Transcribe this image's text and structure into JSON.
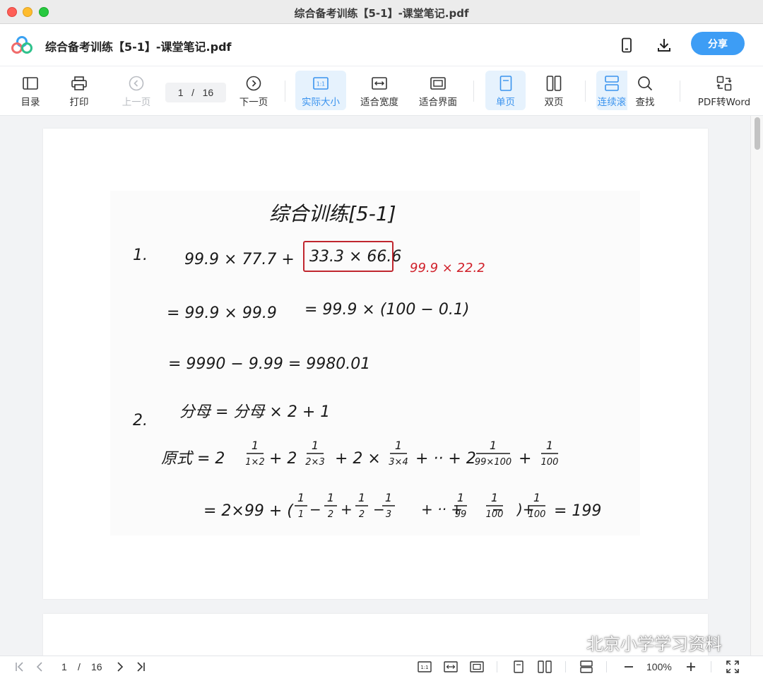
{
  "window": {
    "title": "综合备考训练【5-1】-课堂笔记.pdf"
  },
  "header": {
    "doc_title": "综合备考训练【5-1】-课堂笔记.pdf",
    "share_label": "分享",
    "icons": [
      "phone-icon",
      "download-icon"
    ]
  },
  "toolbar": {
    "toc": "目录",
    "print": "打印",
    "prev_page": "上一页",
    "current_page": "1",
    "page_sep": "/",
    "total_pages": "16",
    "next_page": "下一页",
    "actual_size": "实际大小",
    "fit_width": "适合宽度",
    "fit_window": "适合界面",
    "single_page": "单页",
    "double_page": "双页",
    "continuous": "连续滚",
    "find": "查找",
    "pdf_to_word": "PDF转Word"
  },
  "notes": {
    "title": "综合训练[5-1]",
    "q1_num": "1.",
    "q1_expr": "99.9 × 77.7 +",
    "q1_box": "33.3 × 66.6",
    "q1_red": "99.9 × 22.2",
    "q1_line2a": "= 99.9 × 99.9",
    "q1_line2b": "= 99.9 × (100 − 0.1)",
    "q1_line3": "= 9990 − 9.99 = 9980.01",
    "q2_num": "2.",
    "q2_hint": "分母 = 分母 × 2 + 1",
    "q2_line1_lhs": "原式 = 2",
    "q2_line1_mid1": "+ 2",
    "q2_line1_mid2": "+ 2 ×",
    "q2_line1_mid3": "+ ·· + 2",
    "q2_line1_plus": "+",
    "q2_line2_start": "= 2×99 + (",
    "q2_line2_end": "= 199",
    "fractions": {
      "f1": [
        "1",
        "1×2"
      ],
      "f2": [
        "1",
        "2×3"
      ],
      "f3": [
        "1",
        "3×4"
      ],
      "f4": [
        "1",
        "99×100"
      ],
      "f5": [
        "1",
        "100"
      ],
      "g1": [
        "1",
        "1"
      ],
      "g2": [
        "1",
        "2"
      ],
      "g3": [
        "1",
        "2"
      ],
      "g4": [
        "1",
        "3"
      ],
      "g5": [
        "1",
        "99"
      ],
      "g6": [
        "1",
        "100"
      ],
      "g7": [
        "1",
        "100"
      ]
    }
  },
  "watermark": {
    "text": "北京小学学习资料"
  },
  "bottombar": {
    "current_page": "1",
    "page_sep": "/",
    "total_pages": "16",
    "zoom": "100%",
    "btn_1to1": "1:1"
  },
  "colors": {
    "accent": "#3d9df5",
    "active_bg": "#e6f2fd",
    "ink": "#1a1a1a",
    "red_ink": "#d0202a",
    "box_red": "#c0262e"
  }
}
